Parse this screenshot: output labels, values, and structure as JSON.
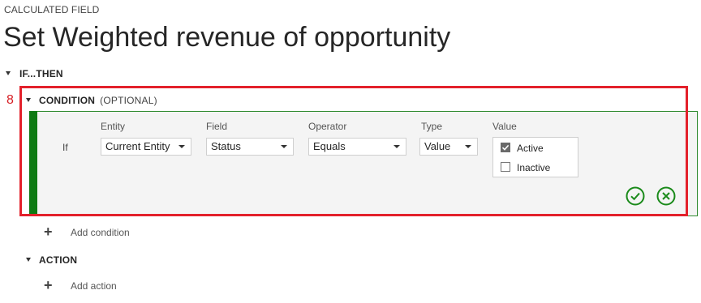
{
  "header": {
    "kicker": "CALCULATED FIELD",
    "title": "Set Weighted revenue of opportunity"
  },
  "ifthen": {
    "label": "IF...THEN"
  },
  "marker": "8",
  "condition": {
    "label": "CONDITION",
    "optional": "(OPTIONAL)",
    "if_label": "If",
    "entity": {
      "label": "Entity",
      "value": "Current Entity"
    },
    "field": {
      "label": "Field",
      "value": "Status"
    },
    "operator": {
      "label": "Operator",
      "value": "Equals"
    },
    "type": {
      "label": "Type",
      "value": "Value"
    },
    "value": {
      "label": "Value",
      "options": [
        {
          "label": "Active",
          "checked": true
        },
        {
          "label": "Inactive",
          "checked": false
        }
      ]
    },
    "confirm_icon": "check-circle-icon",
    "cancel_icon": "x-circle-icon"
  },
  "add_condition": "Add condition",
  "action": {
    "label": "ACTION"
  },
  "add_action": "Add action",
  "colors": {
    "accent_green": "#0f7a13",
    "highlight_red": "#e3212b"
  }
}
